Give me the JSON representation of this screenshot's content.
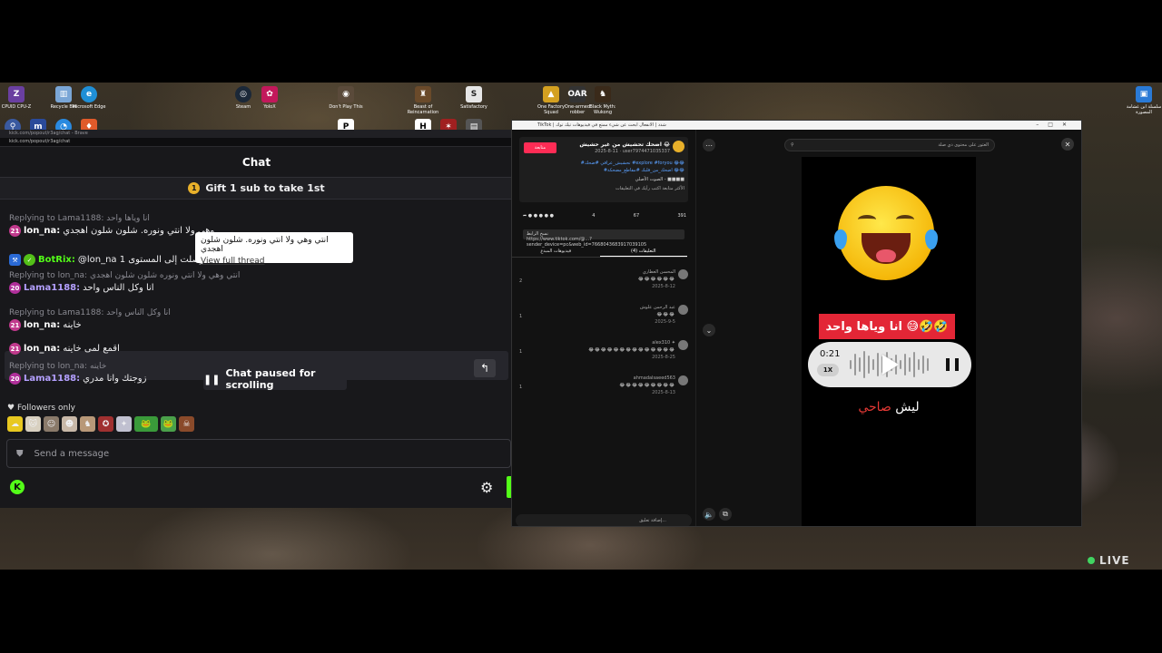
{
  "chat": {
    "window_title": "kick.com/popout/r3ag/chat - Brave",
    "url": "kick.com/popout/r3ag/chat",
    "header": "Chat",
    "gift_label": "Gift 1 sub to take 1st",
    "messages": [
      {
        "reply": "Replying to Lama1188: انا وياها واحد",
        "badge": "21",
        "user": "lon_na:",
        "text": "وهي ولا انتي ونوره. شلون شلون اهجدي"
      },
      {
        "reply": "",
        "badge": "",
        "user": "BotRix:",
        "text": "@lon_na وصلت إلى المستوى 1"
      },
      {
        "reply": "Replying to lon_na: انتي وهي ولا انتي ونوره شلون شلون اهجدي",
        "badge": "20",
        "user": "Lama1188:",
        "text": "انا وكل الناس واحد"
      },
      {
        "reply": "Replying to Lama1188: انا وكل الناس واحد",
        "badge": "21",
        "user": "lon_na:",
        "text": "خاينه"
      },
      {
        "reply": "",
        "badge": "21",
        "user": "lon_na:",
        "text": "اقمع لمى خاينه"
      },
      {
        "reply": "Replying to lon_na: خاينه",
        "badge": "20",
        "user": "Lama1188:",
        "text": "زوجتك وانا مدري"
      }
    ],
    "tooltip_text": "انتي وهي ولا انتي ونوره. شلون شلون اهجدي",
    "tooltip_link": "View full thread",
    "paused_label": "Chat paused for scrolling",
    "followers_label": "Followers only",
    "input_placeholder": "Send a message",
    "colors": {
      "accent": "#53fc18",
      "bg": "#18181b",
      "user_pink": "#ff75e6",
      "user_purple": "#b4a0ff",
      "bot_green": "#53fc18"
    }
  },
  "tiktok": {
    "window_title": "TikTok | شدد | الانفعال ابحث عن شيء ممتع في فيديوهات تيك توك",
    "follow_label": "متابعة",
    "title": "اضحك تحشيش من غير حشيش 😂",
    "subtitle": "2025-8-11 · user7974471035337",
    "desc_lines": [
      "#تحشيش_عراقي #ضحك #explore #foryou 😂😂",
      "#اضحك_من_قلبك #مقاطع_مضحكة 😂😂",
      "الصوت الأصلي - ■■■■",
      "الأكثر متابعة اكتب رأيك في التعليقات"
    ],
    "actions": [
      "391",
      "67",
      "4"
    ],
    "link_text": "https://www.tiktok.com/@...?sender_device=pc&web_id=7668043683917039105",
    "copy_label": "نسخ الرابط",
    "tabs": [
      "التعليقات (4)",
      "فيديوهات المبدع"
    ],
    "comments": [
      {
        "name": "المحسن العطاري",
        "text": "😂😂😂😂😂😂",
        "date": "2025-8-12",
        "likes": "2"
      },
      {
        "name": "عبد الرحمن علوش",
        "text": "😂😂😂",
        "date": "2025-9-5",
        "likes": "1"
      },
      {
        "name": "alex310 ✦",
        "text": "😂😂😂😂😂😂😂😂😂😂😂😂😂😂",
        "date": "2025-8-25",
        "likes": "1"
      },
      {
        "name": "ahmadalsaeed563",
        "text": "😂😂😂😂😂😂😂😂😂",
        "date": "2025-8-13",
        "likes": "1"
      }
    ],
    "comment_placeholder": "إضافة تعليق...",
    "search_placeholder": "العثور على محتوى ذي صلة",
    "video": {
      "caption": "انا وياها واحد 😅🤣🤣",
      "time": "0:21",
      "speed": "1X",
      "lyric_white": "ليش",
      "lyric_red": "صاحي"
    }
  },
  "stream": {
    "live_label": "LIVE"
  },
  "desktop_icons": [
    "CPUID CPU-Z",
    "Recycle Bin",
    "Microsoft Edge",
    "Steam",
    "YoloX",
    "Don't Play This",
    "Beast of Reincarnation",
    "Satisfactory",
    "One Factory Squad",
    "One-armed robber",
    "Black Myth: Wukong",
    "سلسلة ابن غشامة المصورة"
  ]
}
